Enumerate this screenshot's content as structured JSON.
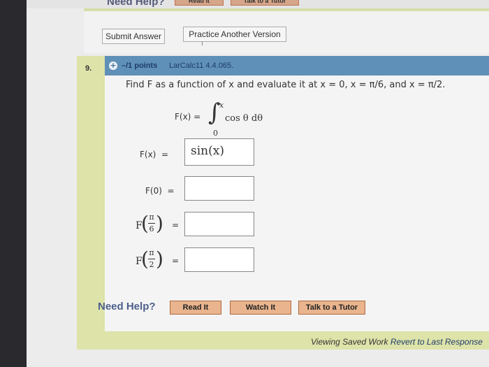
{
  "top": {
    "need_help": "Need Help?",
    "read_it": "Read It",
    "talk_to_tutor": "Talk to a Tutor"
  },
  "toolbar": {
    "submit_answer": "Submit Answer",
    "practice_another": "Practice Another Version"
  },
  "question": {
    "number": "9.",
    "points": "–/1 points",
    "code": "LarCalc11 4.4.065.",
    "prompt_text": "Find F as a function of x and evaluate it at x = 0, x = π/6, and x = π/2.",
    "definition": {
      "lhs": "F(x) =",
      "integral_upper": "x",
      "integral_lower": "0",
      "integrand": "cos θ dθ"
    },
    "answers": [
      {
        "label": "F(x)",
        "value": "sin(x)"
      },
      {
        "label": "F(0)",
        "value": ""
      },
      {
        "label": "F(π/6)",
        "value": ""
      },
      {
        "label": "F(π/2)",
        "value": ""
      }
    ],
    "frac": {
      "f": "F",
      "pi": "π",
      "six": "6",
      "two": "2",
      "eq": "="
    }
  },
  "help": {
    "label": "Need Help?",
    "read_it": "Read It",
    "watch_it": "Watch It",
    "talk_to_tutor": "Talk to a Tutor"
  },
  "footer": {
    "viewing": "Viewing Saved Work",
    "revert": "Revert to Last Response"
  }
}
